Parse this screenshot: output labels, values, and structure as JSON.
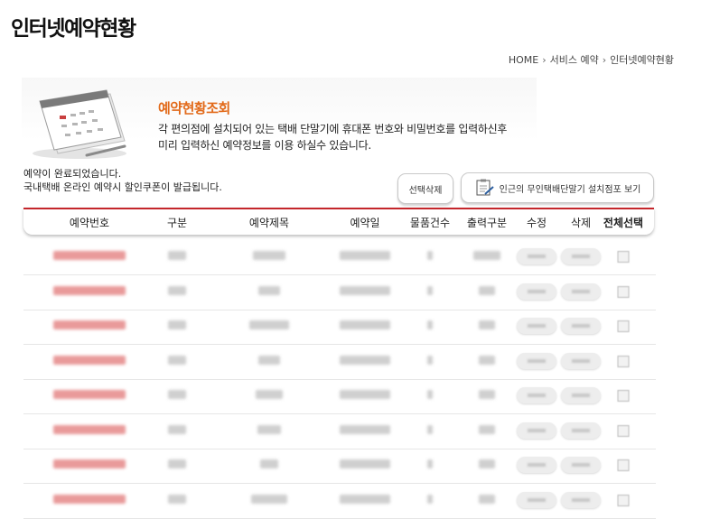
{
  "header": {
    "title": "인터넷예약현황"
  },
  "breadcrumb": {
    "home": "HOME",
    "section": "서비스 예약",
    "current": "인터넷예약현황"
  },
  "banner": {
    "title": "예약현황조회",
    "desc_line1": "각 편의점에 설치되어 있는 택배 단말기에 휴대폰 번호와 비밀번호를 입력하신후",
    "desc_line2": "미리 입력하신 예약정보를 이용 하실수 있습니다."
  },
  "notice": {
    "line1": "예약이 완료되었습니다.",
    "line2": "국내택배 온라인 예약시 할인쿠폰이 발급됩니다."
  },
  "buttons": {
    "select_delete": "선택삭제",
    "store_map": "인근의 무인택배단말기 설치점포 보기"
  },
  "table": {
    "columns": [
      "예약번호",
      "구분",
      "예약제목",
      "예약일",
      "물품건수",
      "출력구분",
      "수정",
      "삭제",
      "전체선택"
    ],
    "row_count": 8
  }
}
